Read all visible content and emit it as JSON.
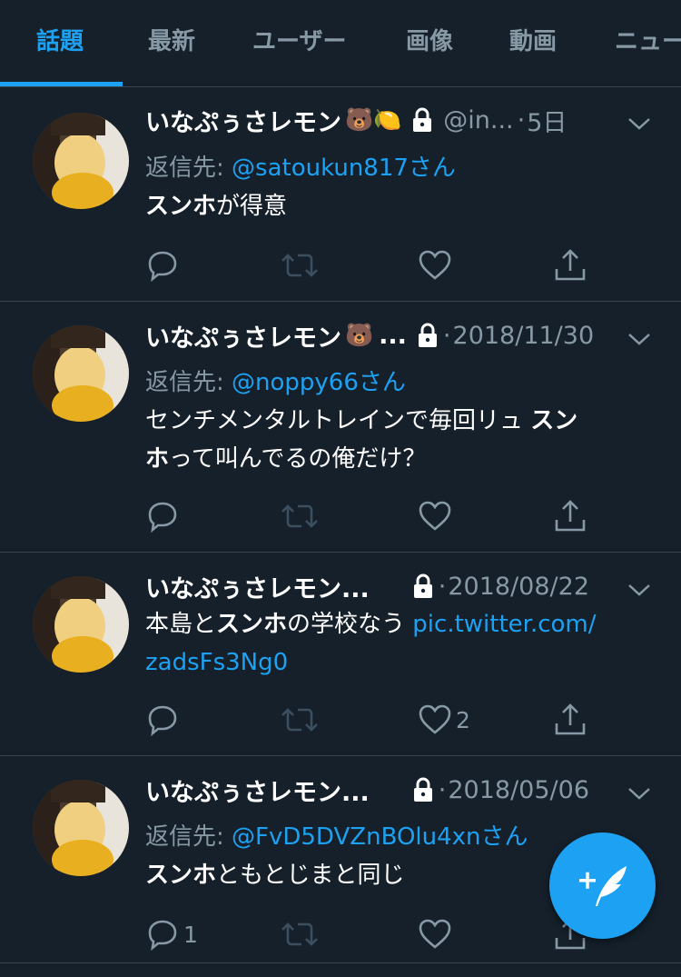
{
  "tabs": [
    {
      "label": "話題",
      "active": true
    },
    {
      "label": "最新",
      "active": false
    },
    {
      "label": "ユーザー",
      "active": false
    },
    {
      "label": "画像",
      "active": false
    },
    {
      "label": "動画",
      "active": false
    },
    {
      "label": "ニュース",
      "active": false
    }
  ],
  "tweets": [
    {
      "name": "いなぷぅさレモン",
      "emojis": "🐻🍋",
      "truncated_marker": "",
      "handle": "@in...",
      "dot": "·",
      "date": "5日",
      "reply_prefix": "返信先: ",
      "reply_mention": "@satoukun817さん",
      "body_bold": "スンホ",
      "body_rest": "が得意",
      "reply_count": "",
      "like_count": ""
    },
    {
      "name": "いなぷぅさレモン",
      "emojis": "🐻",
      "truncated_marker": "...",
      "handle": "",
      "dot": "·",
      "date": "2018/11/30",
      "reply_prefix": "返信先: ",
      "reply_mention": "@noppy66さん",
      "body_pre": "センチメンタルトレインで毎回リュ",
      "body_bold_1": "スン",
      "body_bold_2": "ホ",
      "body_post": "って叫んでるの俺だけ？",
      "reply_count": "",
      "like_count": ""
    },
    {
      "name": "いなぷぅさレモン...",
      "dot": "·",
      "date": "2018/08/22",
      "body_pre": "本島と",
      "body_bold": "スンホ",
      "body_mid": "の学校なう ",
      "link_1": "pic.twitter.com/",
      "link_2": "zadsFs3Ng0",
      "reply_count": "",
      "like_count": "2"
    },
    {
      "name": "いなぷぅさレモン...",
      "dot": "·",
      "date": "2018/05/06",
      "reply_prefix": "返信先: ",
      "reply_mention": "@FvD5DVZnBOlu4xnさん",
      "body_bold": "スンホ",
      "body_rest": "ともとじまと同じ",
      "reply_count": "1",
      "like_count": ""
    }
  ],
  "fab": {
    "icon": "compose-tweet-icon",
    "plus": "+"
  },
  "colors": {
    "background": "#15202b",
    "accent": "#1da1f2",
    "muted": "#8899a6",
    "border": "#38444d"
  }
}
